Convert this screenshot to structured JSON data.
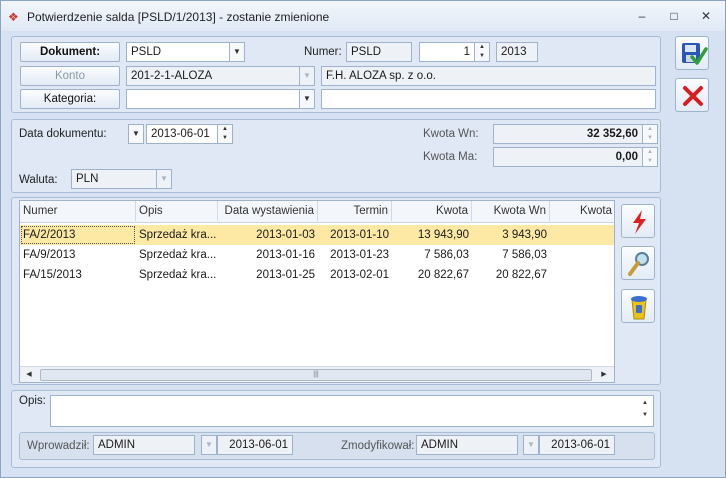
{
  "window": {
    "title": "Potwierdzenie salda [PSLD/1/2013] - zostanie zmienione",
    "minimize": "–",
    "maximize": "□",
    "close": "✕"
  },
  "header": {
    "dokument_label": "Dokument:",
    "dokument_value": "PSLD",
    "numer_label": "Numer:",
    "numer_series": "PSLD",
    "numer_number": "1",
    "numer_year": "2013",
    "konto_label": "Konto",
    "konto_value": "201-2-1-ALOZA",
    "konto_name": "F.H. ALOZA sp. z o.o.",
    "kategoria_label": "Kategoria:",
    "kategoria_value": "",
    "kategoria_desc": ""
  },
  "dates": {
    "data_label": "Data dokumentu:",
    "data_value": "2013-06-01",
    "kwota_wn_label": "Kwota Wn:",
    "kwota_wn_value": "32 352,60",
    "kwota_ma_label": "Kwota Ma:",
    "kwota_ma_value": "0,00",
    "waluta_label": "Waluta:",
    "waluta_value": "PLN"
  },
  "grid": {
    "columns": [
      "Numer",
      "Opis",
      "Data wystawienia",
      "Termin",
      "Kwota",
      "Kwota Wn",
      "Kwota"
    ],
    "rows": [
      {
        "numer": "FA/2/2013",
        "opis": "Sprzedaż kra...",
        "data": "2013-01-03",
        "termin": "2013-01-10",
        "kwota": "13 943,90",
        "kwota_wn": "3 943,90"
      },
      {
        "numer": "FA/9/2013",
        "opis": "Sprzedaż kra...",
        "data": "2013-01-16",
        "termin": "2013-01-23",
        "kwota": "7 586,03",
        "kwota_wn": "7 586,03"
      },
      {
        "numer": "FA/15/2013",
        "opis": "Sprzedaż kra...",
        "data": "2013-01-25",
        "termin": "2013-02-01",
        "kwota": "20 822,67",
        "kwota_wn": "20 822,67"
      }
    ]
  },
  "footer": {
    "opis_label": "Opis:",
    "opis_value": "",
    "wprowadzil_label": "Wprowadził:",
    "wprowadzil_user": "ADMIN",
    "wprowadzil_date": "2013-06-01",
    "zmodyfikowal_label": "Zmodyfikował:",
    "zmodyfikowal_user": "ADMIN",
    "zmodyfikowal_date": "2013-06-01"
  },
  "icons": {
    "save": "save-icon",
    "cancel": "cancel-icon",
    "lightning": "lightning-icon",
    "magnifier": "magnifier-icon",
    "bin": "trash-icon"
  },
  "colors": {
    "selected_row": "#fde9a3",
    "cancel_red": "#d81e1e",
    "save_blue": "#2a57b8"
  }
}
